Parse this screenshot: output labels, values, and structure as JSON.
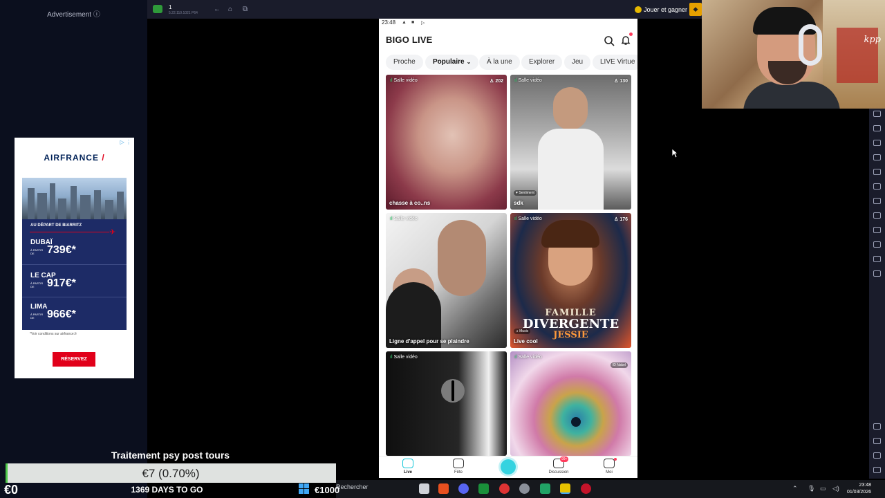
{
  "ad": {
    "label": "Advertisement ⓘ",
    "brand": "AIRFRANCE",
    "brand_stripe": "/",
    "departure": "AU DÉPART DE BIARRITZ",
    "destinations": [
      {
        "city": "DUBAÏ",
        "from": "À PARTIR DE",
        "price": "739€*"
      },
      {
        "city": "LE CAP",
        "from": "À PARTIR DE",
        "price": "917€*"
      },
      {
        "city": "LIMA",
        "from": "À PARTIR DE",
        "price": "966€*"
      }
    ],
    "conditions": "*Voir conditions sur airfrance.fr",
    "cta": "RÉSERVEZ"
  },
  "emulator": {
    "instance": "1",
    "version": "5.22.110.1021 P64",
    "promo": "Jouer et gagner"
  },
  "phone": {
    "status_time": "23:48",
    "app_name": "BIGO LIVE",
    "tabs": [
      {
        "label": "Proche"
      },
      {
        "label": "Populaire",
        "active": true
      },
      {
        "label": "À la une"
      },
      {
        "label": "Explorer"
      },
      {
        "label": "Jeu"
      },
      {
        "label": "LIVE Virtue"
      }
    ],
    "cards": [
      {
        "badge": "Salle vidéo",
        "count": "202",
        "title": "chasse à co..ns",
        "tag": ""
      },
      {
        "badge": "Salle vidéo",
        "count": "130",
        "title": "sdk",
        "tag": "Sentiment"
      },
      {
        "badge": "Salle vidéo",
        "count": "",
        "title": "Ligne d'appel pour se plaindre",
        "tag": ""
      },
      {
        "badge": "Salle vidéo",
        "count": "176",
        "title": "Live cool",
        "tag": "Music"
      },
      {
        "badge": "Salle vidéo",
        "count": "",
        "title": "",
        "tag": ""
      },
      {
        "badge": "Salle vidéo",
        "count": "",
        "title": "",
        "tag": "ID Nakel"
      }
    ],
    "poster": {
      "line1": "FAMILLE",
      "line2": "DIVERGENTE",
      "line3": "JESSIE"
    },
    "bottom_nav": [
      {
        "label": "Live",
        "active": true
      },
      {
        "label": "Fête"
      },
      {
        "label": "Discussion",
        "badge": "99+"
      },
      {
        "label": "Moi"
      }
    ]
  },
  "webcam": {
    "poster_text": "kpp"
  },
  "overlay": {
    "title": "Traitement psy post tours",
    "amount": "€7 (0.70%)",
    "progress": 0.007,
    "start": "€0",
    "days": "1369 DAYS TO GO",
    "goal": "€1000"
  },
  "taskbar": {
    "search": "Rechercher",
    "time": "23:48",
    "date": "01/03/2026"
  }
}
